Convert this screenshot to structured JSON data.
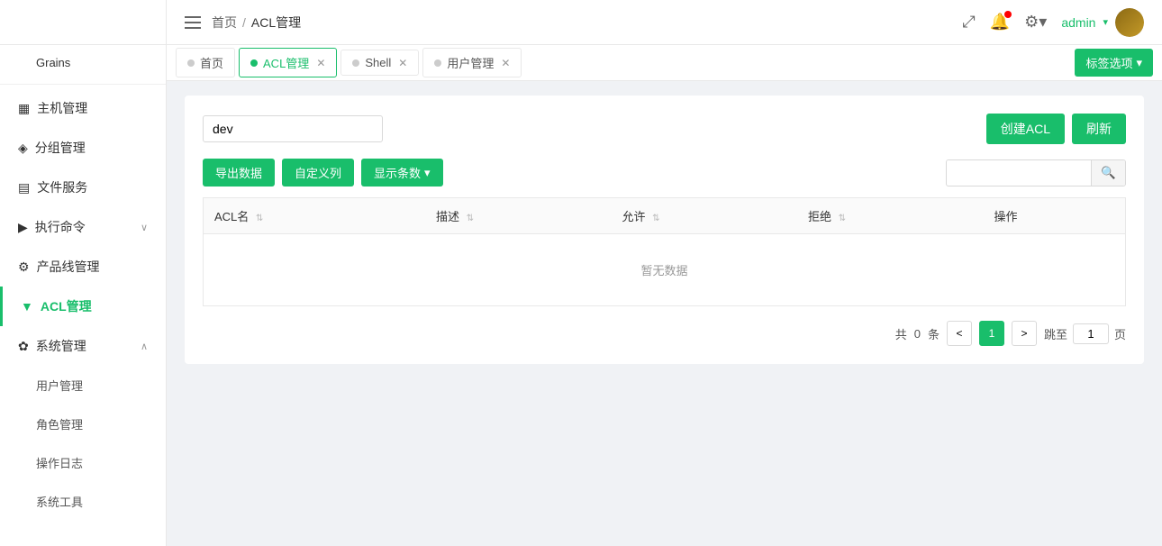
{
  "sidebar": {
    "items": [
      {
        "id": "grains",
        "label": "Grains",
        "icon": "",
        "indent": true,
        "active": false
      },
      {
        "id": "host-mgmt",
        "label": "主机管理",
        "icon": "▦",
        "active": false
      },
      {
        "id": "group-mgmt",
        "label": "分组管理",
        "icon": "◈",
        "active": false
      },
      {
        "id": "file-svc",
        "label": "文件服务",
        "icon": "▤",
        "active": false
      },
      {
        "id": "exec-cmd",
        "label": "执行命令",
        "icon": "▶",
        "active": false,
        "hasArrow": true
      },
      {
        "id": "product-mgmt",
        "label": "产品线管理",
        "icon": "⚙",
        "active": false
      },
      {
        "id": "acl-mgmt",
        "label": "ACL管理",
        "icon": "▼",
        "active": true
      },
      {
        "id": "system-mgmt",
        "label": "系统管理",
        "icon": "✿",
        "active": false,
        "expanded": true
      },
      {
        "id": "user-mgmt",
        "label": "用户管理",
        "indent": true,
        "active": false
      },
      {
        "id": "role-mgmt",
        "label": "角色管理",
        "indent": true,
        "active": false
      },
      {
        "id": "op-log",
        "label": "操作日志",
        "indent": true,
        "active": false
      },
      {
        "id": "sys-tools",
        "label": "系统工具",
        "indent": true,
        "active": false
      }
    ]
  },
  "topbar": {
    "menu_label": "≡",
    "breadcrumb_home": "首页",
    "breadcrumb_sep": "/",
    "breadcrumb_current": "ACL管理",
    "user_name": "admin",
    "expand_icon": "⤢",
    "notification_icon": "🔔",
    "settings_icon": "⚙"
  },
  "tabs": {
    "items": [
      {
        "id": "home",
        "label": "首页",
        "closable": false,
        "active": false
      },
      {
        "id": "acl",
        "label": "ACL管理",
        "closable": true,
        "active": true
      },
      {
        "id": "shell",
        "label": "Shell",
        "closable": true,
        "active": false
      },
      {
        "id": "user-mgmt",
        "label": "用户管理",
        "closable": true,
        "active": false
      }
    ],
    "tags_btn": "标签选项"
  },
  "toolbar": {
    "search_value": "dev",
    "search_placeholder": "",
    "create_btn": "创建ACL",
    "refresh_btn": "刷新"
  },
  "filters": {
    "export_btn": "导出数据",
    "custom_cols_btn": "自定义列",
    "show_rows_btn": "显示条数",
    "search_placeholder": ""
  },
  "table": {
    "columns": [
      {
        "key": "acl_name",
        "label": "ACL名",
        "sortable": true
      },
      {
        "key": "description",
        "label": "描述",
        "sortable": true
      },
      {
        "key": "allow",
        "label": "允许",
        "sortable": true
      },
      {
        "key": "deny",
        "label": "拒绝",
        "sortable": true
      },
      {
        "key": "actions",
        "label": "操作",
        "sortable": false
      }
    ],
    "empty_text": "暂无数据",
    "rows": []
  },
  "pagination": {
    "total_prefix": "共",
    "total": "0",
    "total_suffix": "条",
    "prev_icon": "<",
    "next_icon": ">",
    "current_page": "1",
    "jump_prefix": "跳至",
    "jump_suffix": "页",
    "jump_value": "1"
  },
  "colors": {
    "primary": "#19be6b",
    "active_sidebar": "#19be6b",
    "border": "#e8e8e8",
    "bg": "#f0f2f5"
  }
}
